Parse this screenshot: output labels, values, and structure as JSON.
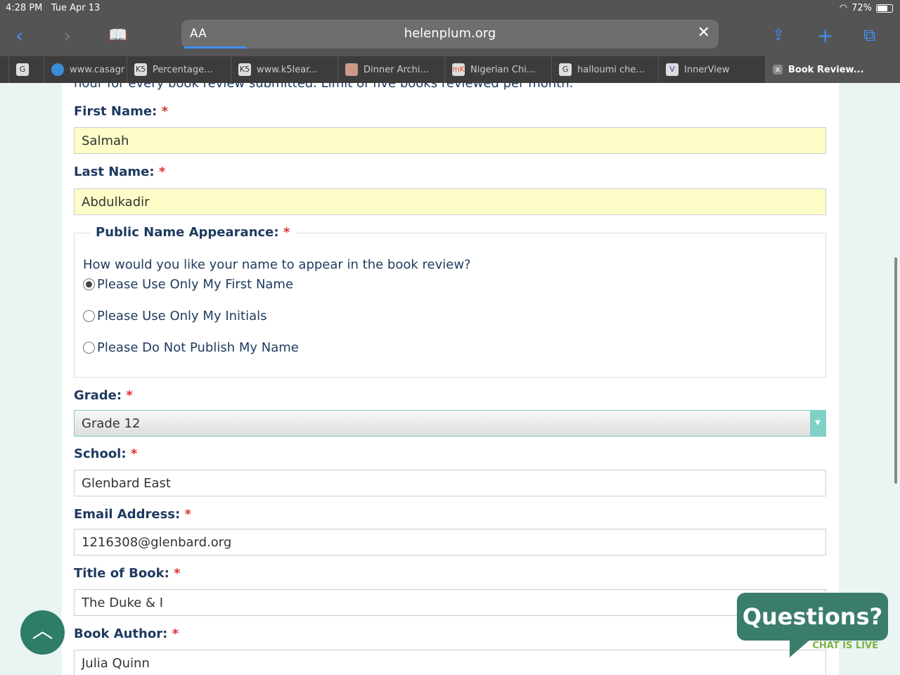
{
  "status": {
    "time": "4:28 PM",
    "date": "Tue Apr 13",
    "battery": "72%"
  },
  "browser": {
    "aa": "AA",
    "url": "helenplum.org"
  },
  "tabs": [
    {
      "label": "",
      "icon": "G"
    },
    {
      "label": "www.casagr",
      "icon": "globe"
    },
    {
      "label": "Percentage...",
      "icon": "K5"
    },
    {
      "label": "www.k5lear...",
      "icon": "K5"
    },
    {
      "label": "Dinner Archi...",
      "icon": "img"
    },
    {
      "label": "Nigerian Chi...",
      "icon": "mK"
    },
    {
      "label": "halloumi che...",
      "icon": "G"
    },
    {
      "label": "InnerView",
      "icon": "V"
    },
    {
      "label": "Book Review...",
      "icon": "x"
    }
  ],
  "form": {
    "intro_cut": "hour for every book review submitted. Limit of five books reviewed per month.",
    "required": "*",
    "first_name_label": "First Name:",
    "first_name": "Salmah",
    "last_name_label": "Last Name:",
    "last_name": "Abdulkadir",
    "public_name_label": "Public Name Appearance:",
    "public_name_question": "How would you like your name to appear in the book review?",
    "options": [
      "Please Use Only My First Name",
      "Please Use Only My Initials",
      "Please Do Not Publish My Name"
    ],
    "selected_option": 0,
    "grade_label": "Grade:",
    "grade": "Grade 12",
    "school_label": "School:",
    "school": "Glenbard East",
    "email_label": "Email Address:",
    "email": "1216308@glenbard.org",
    "title_label": "Title of Book:",
    "title": "The Duke & I",
    "author_label": "Book Author:",
    "author": "Julia Quinn"
  },
  "chat": {
    "title": "Questions?",
    "subtitle": "CHAT IS LIVE"
  }
}
